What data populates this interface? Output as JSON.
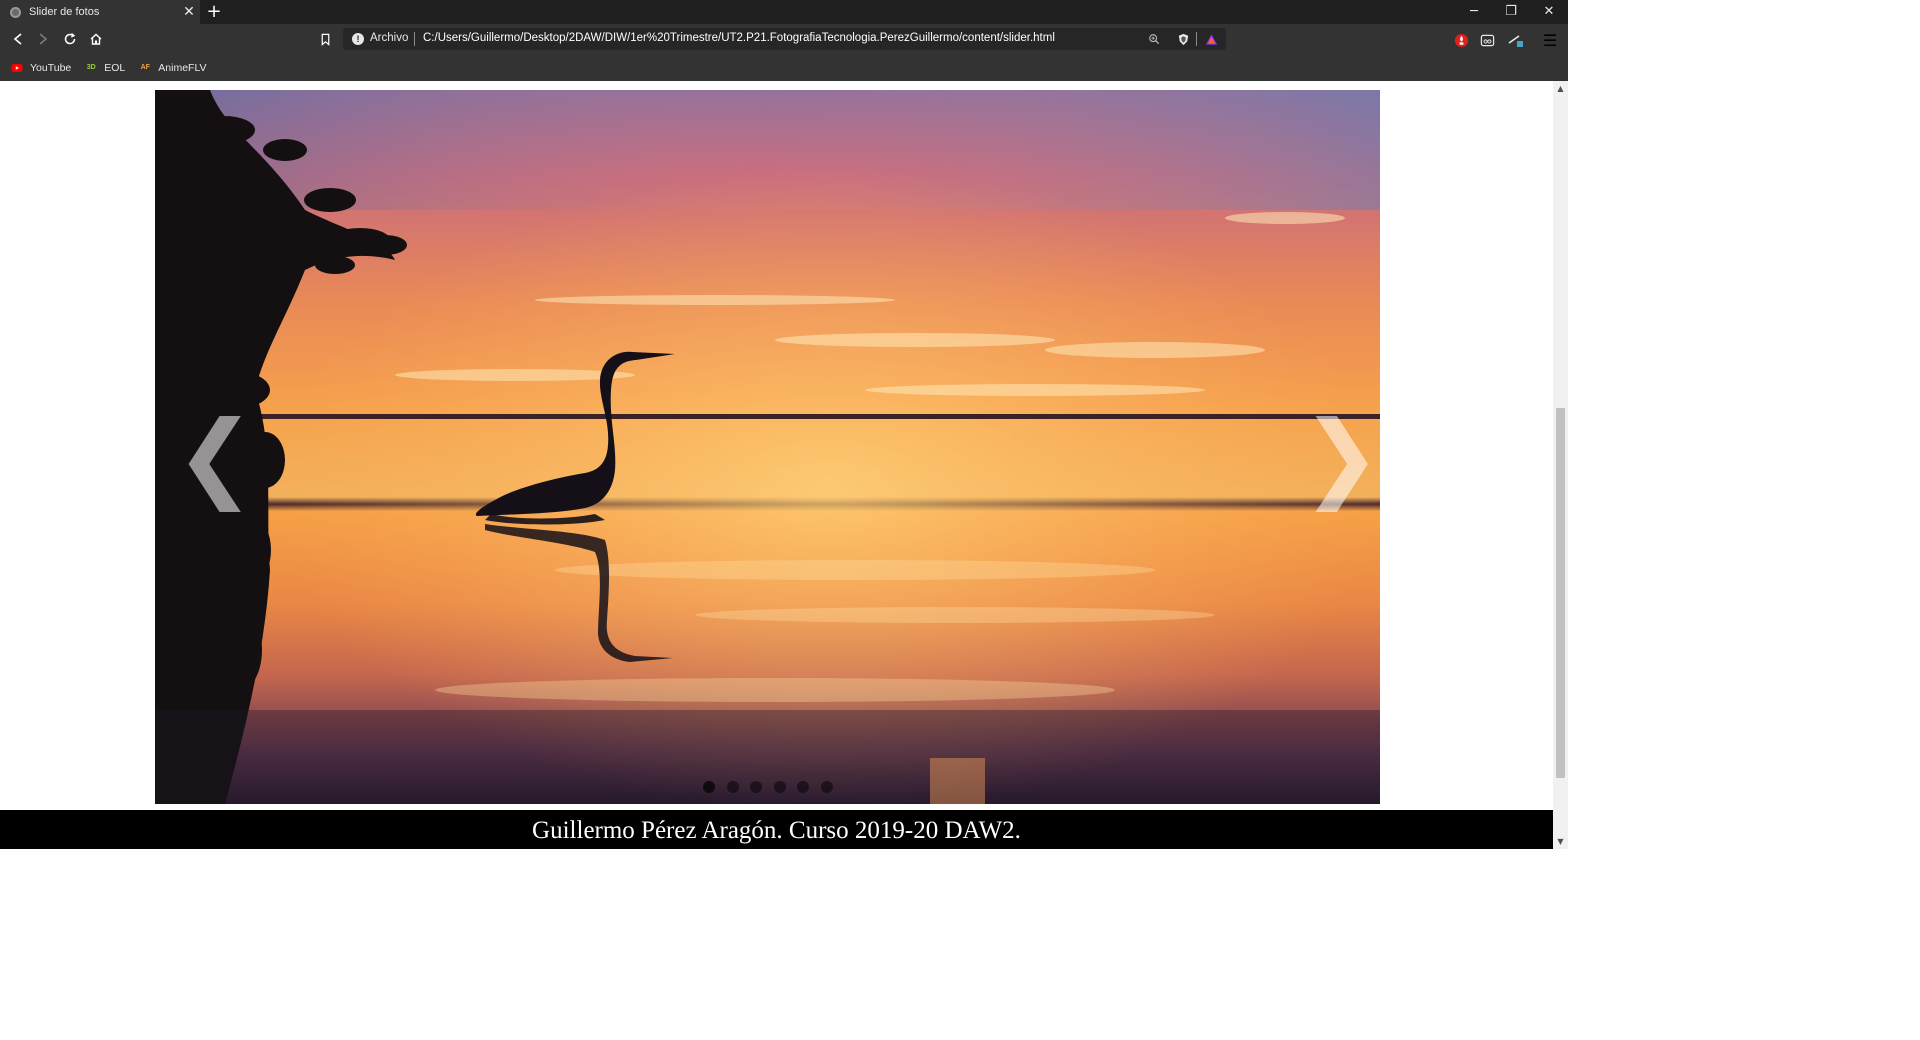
{
  "browser": {
    "tab": {
      "title": "Slider de fotos",
      "close_glyph": "✕"
    },
    "new_tab_glyph": "+",
    "window_controls": {
      "minimize": "─",
      "restore": "❐",
      "close": "✕"
    },
    "address": {
      "scheme_label": "Archivo",
      "url": "C:/Users/Guillermo/Desktop/2DAW/DIW/1er%20Trimestre/UT2.P21.FotografiaTecnologia.PerezGuillermo/content/slider.html"
    },
    "bookmarks": [
      {
        "label": "YouTube",
        "icon": "youtube-icon"
      },
      {
        "label": "EOL",
        "icon": "eol-icon"
      },
      {
        "label": "AnimeFLV",
        "icon": "animeflv-icon"
      }
    ],
    "menu_glyph": "☰"
  },
  "slider": {
    "prev_glyph": "❮",
    "next_glyph": "❯",
    "slide_count": 6,
    "active_slide": 1,
    "photo_subject": "sunset-heron-photo"
  },
  "footer": {
    "text": "Guillermo Pérez Aragón. Curso 2019-20 DAW2."
  },
  "colors": {
    "chrome_dark": "#333333",
    "tabbar": "#1f1f1f",
    "footer_bg": "#000000",
    "footer_text": "#ffffff"
  }
}
